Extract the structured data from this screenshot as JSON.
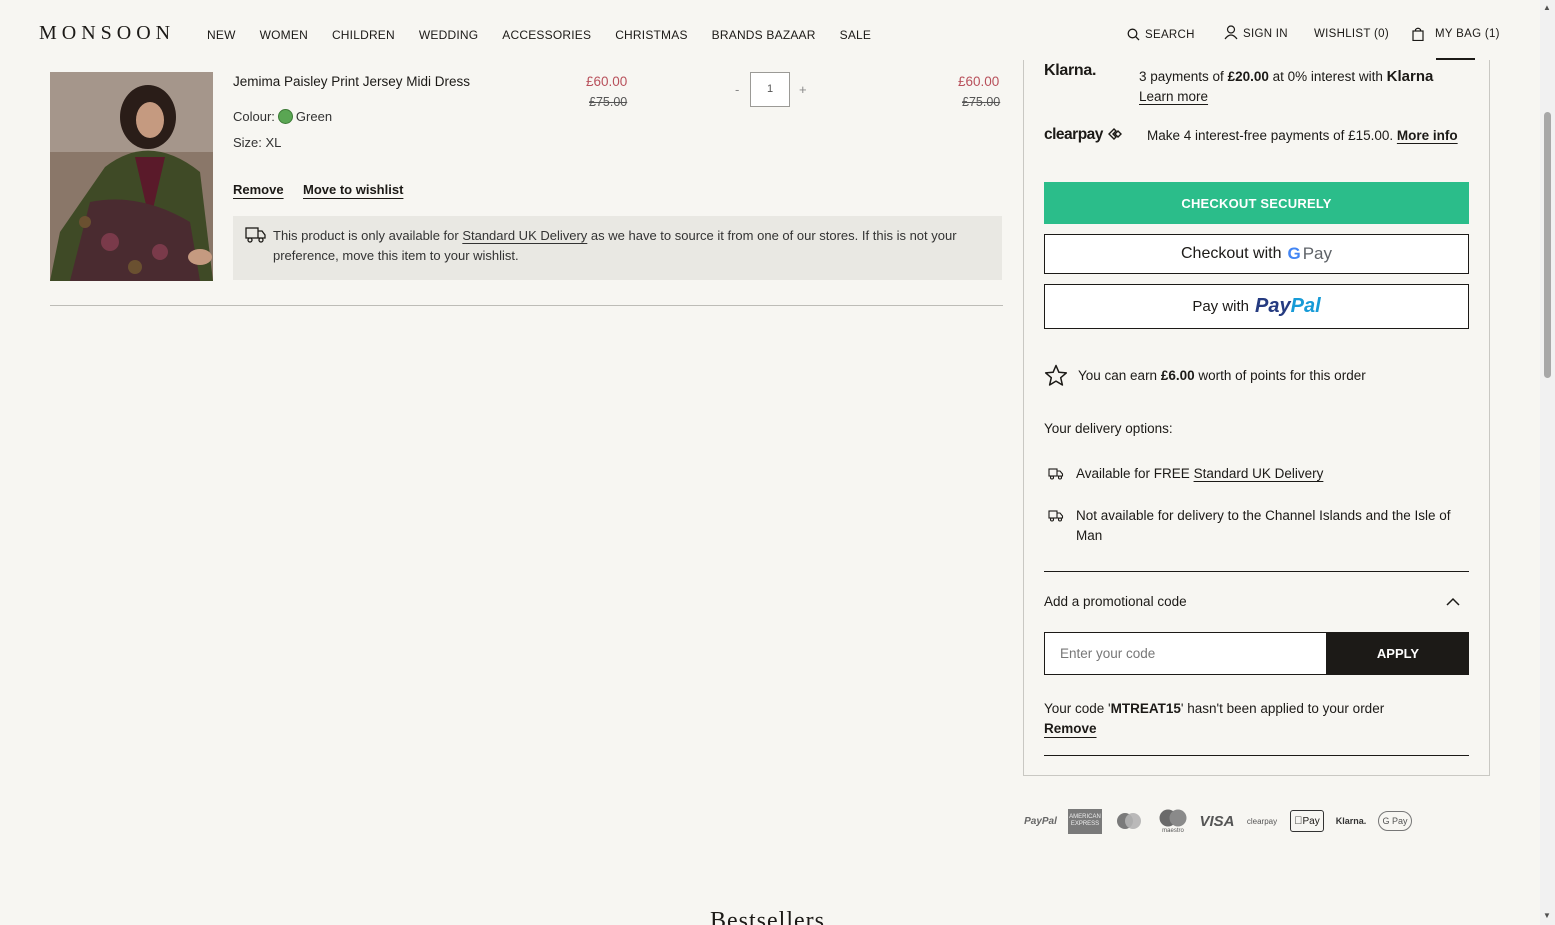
{
  "header": {
    "logo": "MONSOON",
    "nav": [
      "NEW",
      "WOMEN",
      "CHILDREN",
      "WEDDING",
      "ACCESSORIES",
      "CHRISTMAS",
      "BRANDS BAZAAR",
      "SALE"
    ],
    "search_label": "SEARCH",
    "signin_label": "SIGN IN",
    "wishlist_label": "WISHLIST (0)",
    "bag_label": "MY BAG (1)"
  },
  "item": {
    "name": "Jemima Paisley Print Jersey Midi Dress",
    "price": "£60.00",
    "was_price": "£75.00",
    "colour_label": "Colour:",
    "colour": "Green",
    "size": "Size: XL",
    "qty": "1",
    "qty_minus": "-",
    "qty_plus": "+",
    "total": "£60.00",
    "total_was": "£75.00",
    "remove": "Remove",
    "move": "Move to wishlist",
    "notice_pre": "This product is only available for ",
    "notice_link": "Standard UK Delivery",
    "notice_post": " as we have to source it from one of our stores. If this is not your preference, move this item to your wishlist."
  },
  "summary": {
    "klarna_logo": "Klarna.",
    "klarna_pre": "3 payments of ",
    "klarna_amount": "£20.00",
    "klarna_mid": " at 0% interest with ",
    "klarna_brand": "Klarna",
    "klarna_link": "Learn more",
    "clearpay_logo": "clearpay",
    "clearpay_text": "Make 4 interest-free payments of £15.00. ",
    "clearpay_link": "More info",
    "checkout_label": "CHECKOUT SECURELY",
    "gpay_pre": "Checkout with",
    "gpay_g": "G",
    "gpay_pay": "Pay",
    "paypal_pre": "Pay with",
    "paypal_brand_a": "Pay",
    "paypal_brand_b": "Pal",
    "points_pre": "You can earn ",
    "points_amount": "£6.00",
    "points_post": " worth of points for this order",
    "delivery_title": "Your delivery options:",
    "delivery_1_pre": "Available for FREE ",
    "delivery_1_link": "Standard UK Delivery",
    "delivery_2": "Not available for delivery to the Channel Islands and the Isle of Man",
    "promo_title": "Add a promotional code",
    "promo_placeholder": "Enter your code",
    "apply_label": "APPLY",
    "code_msg_pre": "Your code '",
    "code": "MTREAT15",
    "code_msg_post": "' hasn't been applied to your order",
    "code_remove": "Remove"
  },
  "payment_icons": [
    "PayPal",
    "American Express",
    "Mastercard",
    "Maestro",
    "VISA",
    "clearpay",
    "Apple Pay",
    "Klarna.",
    "G Pay"
  ],
  "payment_icon_text": {
    "paypal": "PayPal",
    "amex_a": "AMERICAN",
    "amex_b": "EXPRESS",
    "maestro": "maestro",
    "visa": "VISA",
    "clearpay": "clearpay",
    "applepay": "Pay",
    "klarna": "Klarna.",
    "gpay": "G Pay"
  },
  "bestsellers_title": "Bestsellers",
  "colors": {
    "sale": "#b8505b",
    "checkout": "#2bbd8a",
    "swatch": "#5aa653",
    "dark": "#1c1a17",
    "paypal_dark": "#253b80",
    "paypal_light": "#179bd7"
  }
}
